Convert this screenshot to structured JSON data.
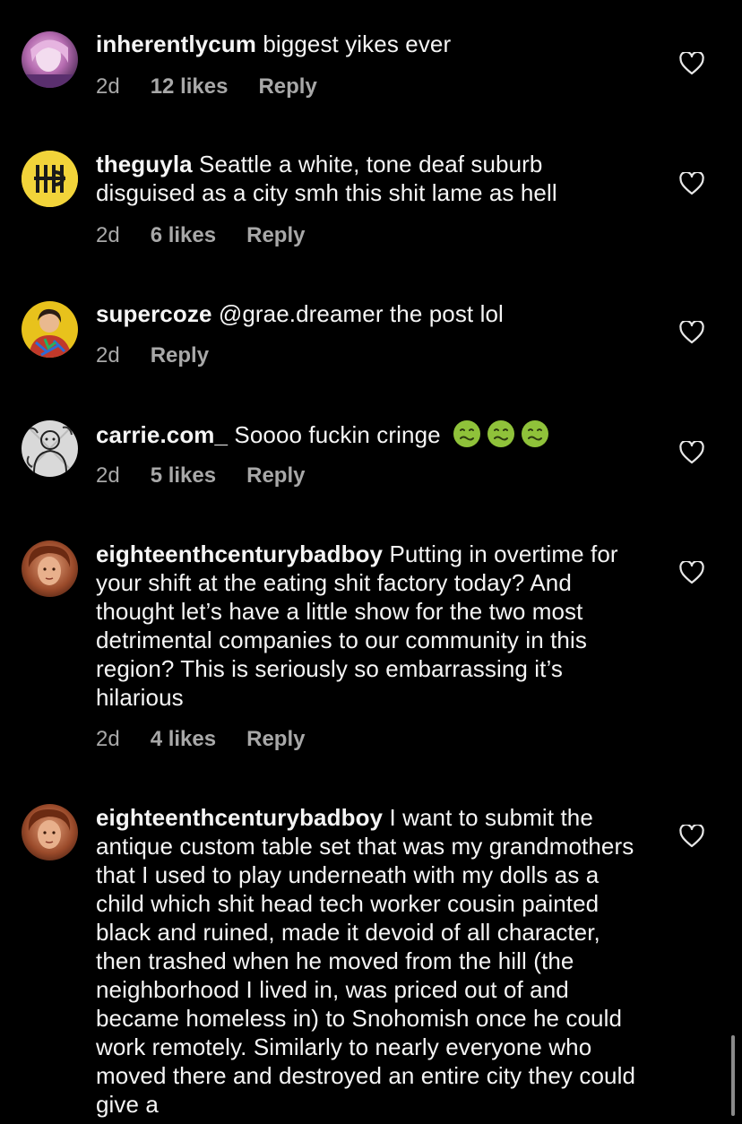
{
  "comments": [
    {
      "username": "inherentlycum",
      "text": "biggest yikes ever",
      "time": "2d",
      "likes": "12 likes",
      "reply": "Reply"
    },
    {
      "username": "theguyla",
      "text": "Seattle a white, tone deaf suburb disguised as a city smh this shit lame as hell",
      "time": "2d",
      "likes": "6 likes",
      "reply": "Reply"
    },
    {
      "username": "supercoze",
      "text": "@grae.dreamer the post lol",
      "time": "2d",
      "likes": "",
      "reply": "Reply"
    },
    {
      "username": "carrie.com_",
      "text": "Soooo fuckin cringe",
      "emoji": "nauseated-face-emoji",
      "emoji_count": 3,
      "time": "2d",
      "likes": "5 likes",
      "reply": "Reply"
    },
    {
      "username": "eighteenthcenturybadboy",
      "text": "Putting in overtime for your shift at the eating shit factory today? And thought let’s have a little show for the two most detrimental companies to our community in this region? This is seriously so embarrassing it’s hilarious",
      "time": "2d",
      "likes": "4 likes",
      "reply": "Reply"
    },
    {
      "username": "eighteenthcenturybadboy",
      "text": "I want to submit the antique custom table set that was my grandmothers that I used to play underneath with my dolls as a child which shit head tech worker cousin painted black and ruined, made it devoid of all character, then trashed when he moved from the hill (the neighborhood I lived in, was priced out of and became homeless in) to Snohomish once he could work remotely. Similarly to nearly everyone who moved there and destroyed an entire city they could give a",
      "time": "",
      "likes": "",
      "reply": ""
    }
  ],
  "icons": {
    "like": "heart-outline-icon"
  },
  "colors": {
    "background": "#000000",
    "text": "#f5f5f5",
    "meta": "#a8a8a8",
    "theguyla_avatar_bg": "#f2d43a"
  }
}
